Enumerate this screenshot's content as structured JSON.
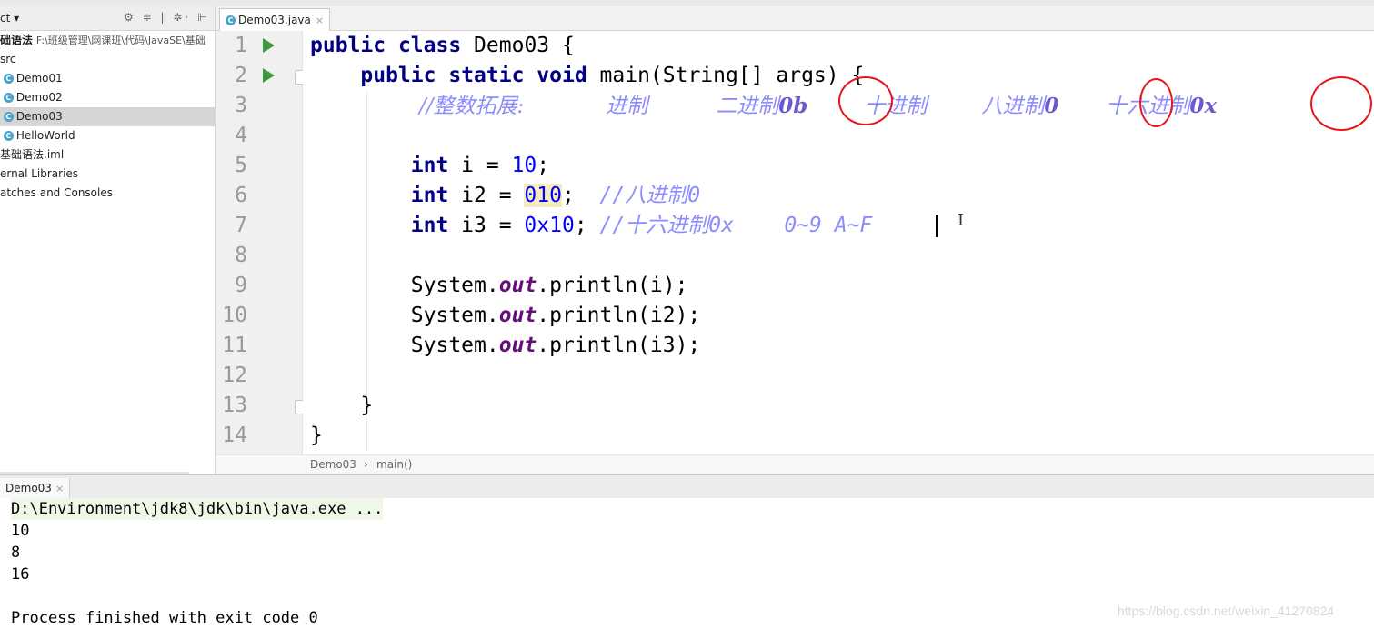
{
  "project_panel": {
    "header_title": "ct ▾",
    "header_tools": "⚙ ≑ | ✲· ⊩",
    "root_label": "础语法",
    "root_path": "F:\\班级管理\\网课班\\代码\\JavaSE\\基础",
    "items": [
      {
        "label": "src"
      },
      {
        "label": "Demo01",
        "icon": "C"
      },
      {
        "label": "Demo02",
        "icon": "C"
      },
      {
        "label": "Demo03",
        "icon": "C"
      },
      {
        "label": "HelloWorld",
        "icon": "C"
      },
      {
        "label": "基础语法.iml"
      },
      {
        "label": "ernal Libraries"
      },
      {
        "label": "atches and Consoles"
      }
    ]
  },
  "editor": {
    "tab": {
      "label": "Demo03.java",
      "close": "×",
      "icon": "C"
    },
    "line_numbers": [
      "1",
      "2",
      "3",
      "4",
      "5",
      "6",
      "7",
      "8",
      "9",
      "10",
      "11",
      "12",
      "13",
      "14"
    ],
    "highlight_color": "#fffae3",
    "code": {
      "l1": {
        "kw1": "public",
        "kw2": "class",
        "rest": " Demo03 {"
      },
      "l2": {
        "kw1": "public",
        "kw2": "static",
        "kw3": "void",
        "rest": " main(String[] args) {"
      },
      "l3": {
        "c1": "//整数拓展:",
        "c2": "进制",
        "c3": "二进制",
        "c3b": "0b",
        "c4": "十进制",
        "c5": "八进制",
        "c5b": "0",
        "c6": "十六进制",
        "c6b": "0x"
      },
      "l5": {
        "kw": "int",
        "mid": " i = ",
        "num": "10",
        "end": ";"
      },
      "l6": {
        "kw": "int",
        "mid": " i2 = ",
        "num": "010",
        "end": ";",
        "com": "//八进制",
        "comb": "0"
      },
      "l7": {
        "kw": "int",
        "mid": " i3 = ",
        "num": "0x10",
        "end": ";",
        "com": "//十六进制",
        "comb": "0x",
        "comb2": "0~9 A~F"
      },
      "l9": {
        "a": "System.",
        "f": "out",
        "b": ".println(i);"
      },
      "l10": {
        "a": "System.",
        "f": "out",
        "b": ".println(i2);"
      },
      "l11": {
        "a": "System.",
        "f": "out",
        "b": ".println(i3);"
      },
      "l13": {
        "t": "}"
      },
      "l14": {
        "t": "}"
      }
    }
  },
  "breadcrumb": {
    "class": "Demo03",
    "sep": "›",
    "method": "main()"
  },
  "run_panel": {
    "tab_label": "Demo03",
    "tab_close": "×",
    "command": "D:\\Environment\\jdk8\\jdk\\bin\\java.exe ...",
    "output": [
      "10",
      "8",
      "16"
    ],
    "exit": "Process finished with exit code 0"
  },
  "watermark": "https://blog.csdn.net/weixin_41270824"
}
